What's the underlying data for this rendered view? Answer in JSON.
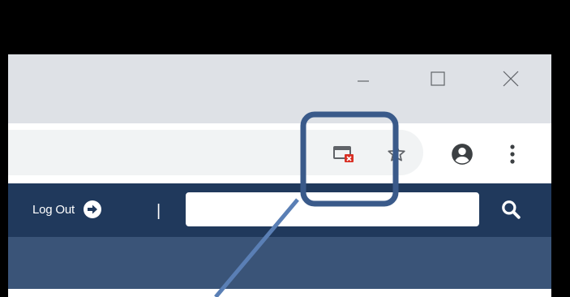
{
  "window": {
    "minimize_icon": "minimize-icon",
    "maximize_icon": "maximize-icon",
    "close_icon": "close-icon"
  },
  "toolbar": {
    "popup_blocked_icon": "popup-blocked-icon",
    "bookmark_icon": "star-icon",
    "profile_icon": "account-circle-icon",
    "menu_icon": "more-vert-icon"
  },
  "site_header": {
    "logout_label": "Log Out",
    "logout_icon": "arrow-circle-right-icon",
    "separator": "|",
    "search_value": "",
    "search_icon": "search-icon"
  },
  "colors": {
    "header_bg": "#20395c",
    "subnav_bg": "#3a5478",
    "titlebar_bg": "#dee1e6",
    "annotation": "#3a5a8a",
    "blocked_red": "#d93025"
  }
}
